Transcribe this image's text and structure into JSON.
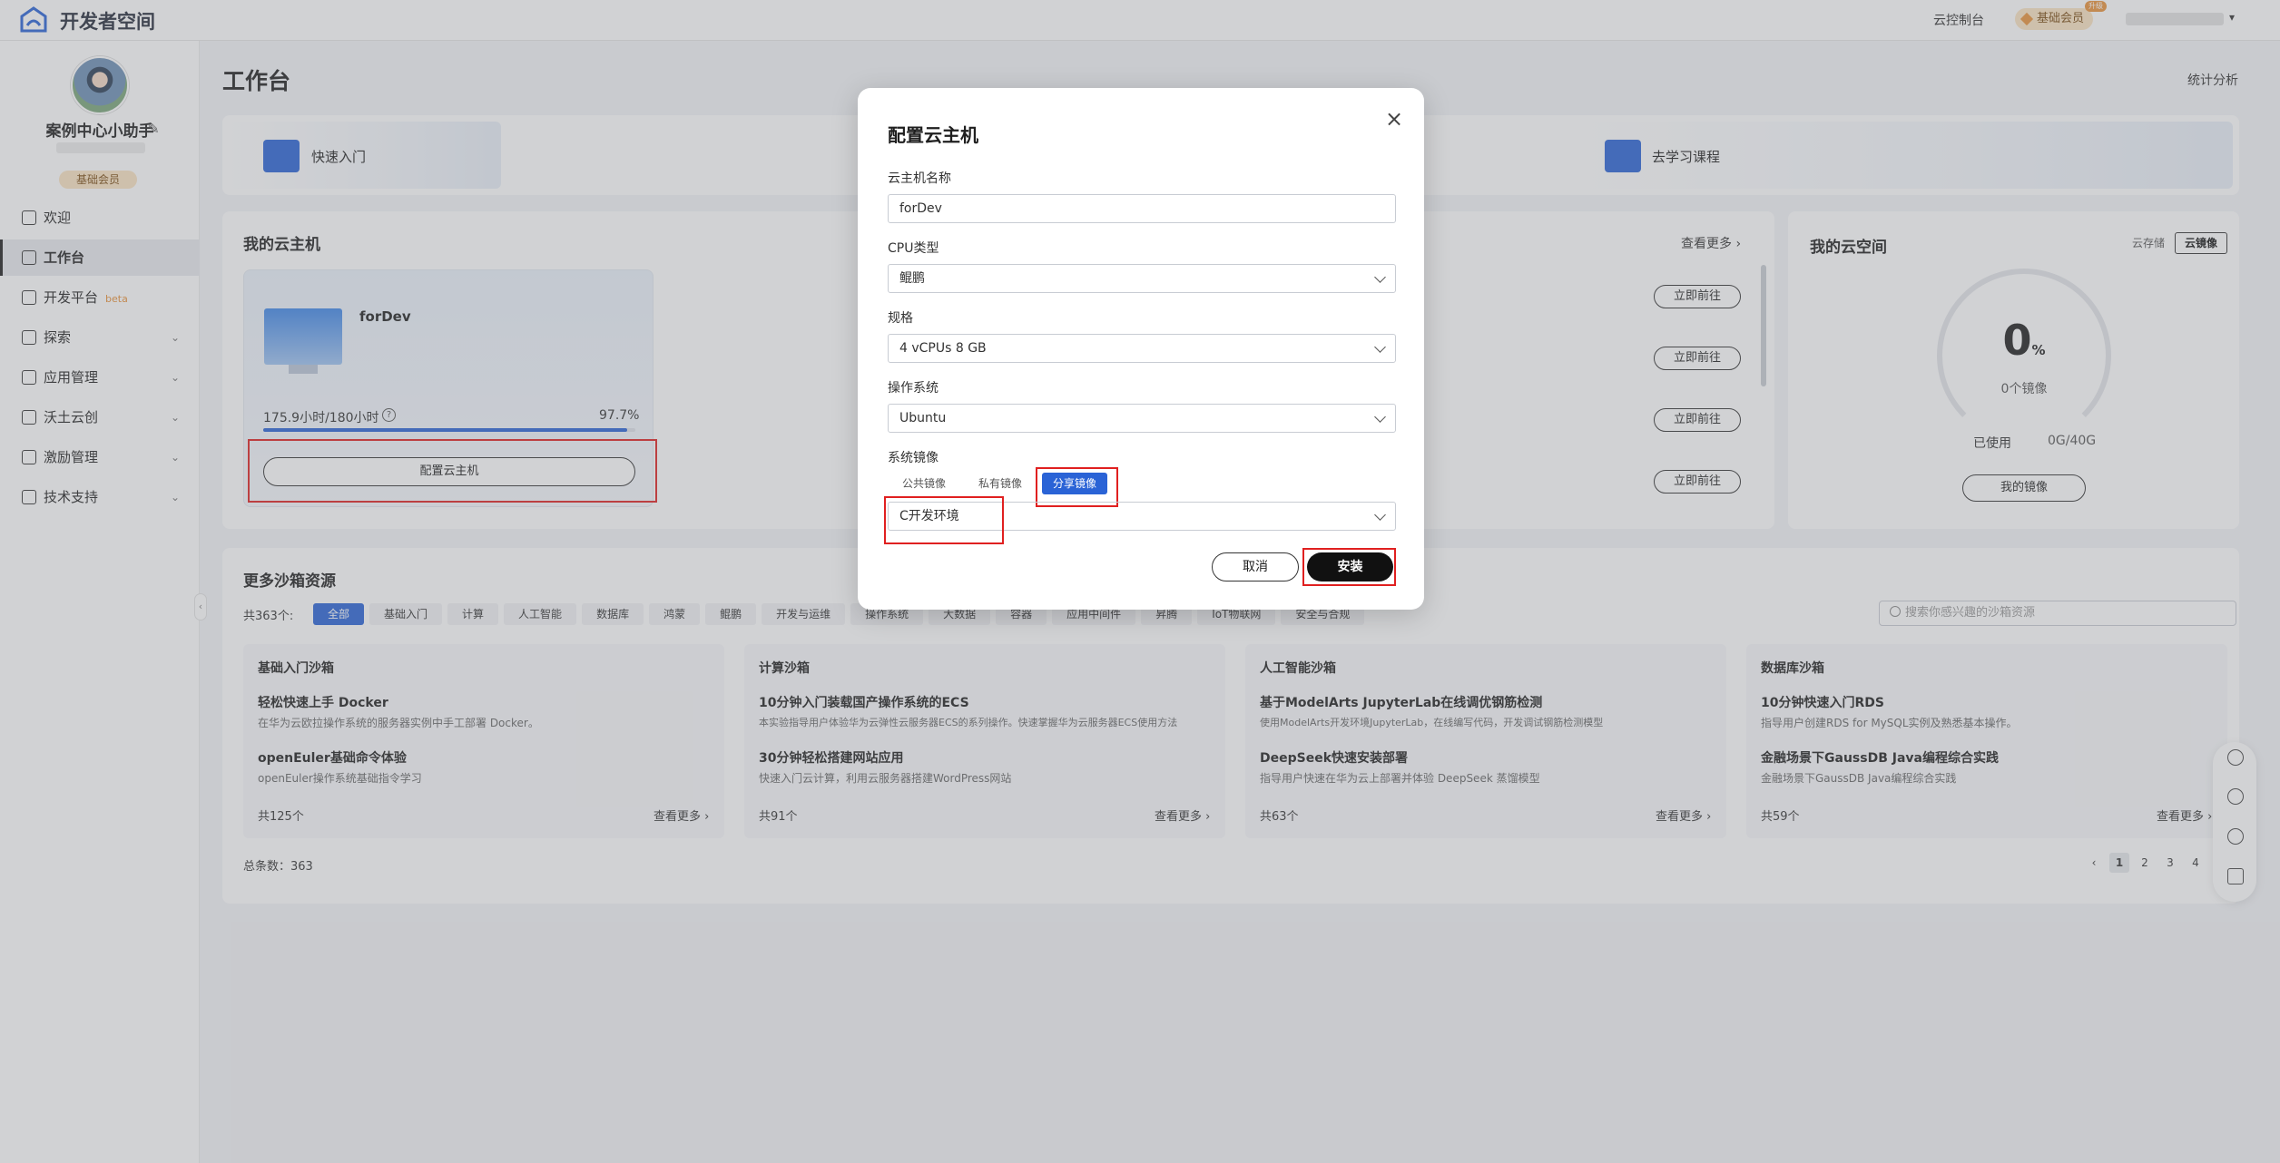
{
  "topbar": {
    "logo_text": "开发者空间",
    "console": "云控制台",
    "member_badge": "基础会员",
    "member_tag": "升级",
    "caret": "▾"
  },
  "sidebar": {
    "username": "案例中心小助手",
    "member": "基础会员",
    "items": [
      {
        "label": "欢迎",
        "icon": "home-icon"
      },
      {
        "label": "工作台",
        "icon": "desk-icon"
      },
      {
        "label": "开发平台",
        "icon": "monitor-icon",
        "badge": "beta"
      },
      {
        "label": "探索",
        "icon": "compass-icon"
      },
      {
        "label": "应用管理",
        "icon": "app-icon"
      },
      {
        "label": "沃土云创",
        "icon": "cloud-icon"
      },
      {
        "label": "激励管理",
        "icon": "gift-icon"
      },
      {
        "label": "技术支持",
        "icon": "support-icon"
      }
    ]
  },
  "main": {
    "title": "工作台",
    "stats_link": "统计分析",
    "quick": [
      {
        "label": "快速入门"
      },
      {
        "label": "去学习课程"
      }
    ],
    "cloud": {
      "title": "我的云主机",
      "see_more": "查看更多 ›",
      "vm_name": "forDev",
      "hours": "175.9小时/180小时",
      "percent_text": "97.7%",
      "percent_value": 0.977,
      "config_button": "配置云主机",
      "goto_label": "立即前往"
    },
    "space": {
      "title": "我的云空间",
      "tab_storage": "云存储",
      "tab_image": "云镜像",
      "ring_value": "0",
      "ring_unit": "%",
      "ring_label": "0个镜像",
      "used_label": "已使用",
      "used_value": "0G/40G",
      "my_image_button": "我的镜像"
    },
    "sandbox": {
      "title": "更多沙箱资源",
      "total_label": "共363个:",
      "filters": [
        "全部",
        "基础入门",
        "计算",
        "人工智能",
        "数据库",
        "鸿蒙",
        "鲲鹏",
        "开发与运维",
        "操作系统",
        "大数据",
        "容器",
        "应用中间件",
        "昇腾",
        "IoT物联网",
        "安全与合规"
      ],
      "search_placeholder": "搜索你感兴趣的沙箱资源",
      "categories": [
        {
          "title": "基础入门沙箱",
          "items": [
            {
              "title": "轻松快速上手 Docker",
              "desc": "在华为云欧拉操作系统的服务器实例中手工部署 Docker。"
            },
            {
              "title": "openEuler基础命令体验",
              "desc": "openEuler操作系统基础指令学习"
            }
          ],
          "count": "共125个",
          "more": "查看更多 ›"
        },
        {
          "title": "计算沙箱",
          "items": [
            {
              "title": "10分钟入门装载国产操作系统的ECS",
              "desc": "本实验指导用户体验华为云弹性云服务器ECS的系列操作。快速掌握华为云服务器ECS使用方法"
            },
            {
              "title": "30分钟轻松搭建网站应用",
              "desc": "快速入门云计算，利用云服务器搭建WordPress网站"
            }
          ],
          "count": "共91个",
          "more": "查看更多 ›"
        },
        {
          "title": "人工智能沙箱",
          "items": [
            {
              "title": "基于ModelArts JupyterLab在线调优钢筋检测",
              "desc": "使用ModelArts开发环境JupyterLab，在线编写代码，开发调试钢筋检测模型"
            },
            {
              "title": "DeepSeek快速安装部署",
              "desc": "指导用户快速在华为云上部署并体验 DeepSeek 蒸馏模型"
            }
          ],
          "count": "共63个",
          "more": "查看更多 ›"
        },
        {
          "title": "数据库沙箱",
          "items": [
            {
              "title": "10分钟快速入门RDS",
              "desc": "指导用户创建RDS for MySQL实例及熟悉基本操作。"
            },
            {
              "title": "金融场景下GaussDB Java编程综合实践",
              "desc": "金融场景下GaussDB Java编程综合实践"
            }
          ],
          "count": "共59个",
          "more": "查看更多 ›"
        }
      ],
      "total_count": "总条数：363",
      "pages": [
        "‹",
        "1",
        "2",
        "3",
        "4"
      ]
    }
  },
  "modal": {
    "title": "配置云主机",
    "name_label": "云主机名称",
    "name_value": "forDev",
    "cpu_label": "CPU类型",
    "cpu_value": "鲲鹏",
    "spec_label": "规格",
    "spec_value": "4 vCPUs 8 GB",
    "os_label": "操作系统",
    "os_value": "Ubuntu",
    "image_label": "系统镜像",
    "image_tabs": [
      "公共镜像",
      "私有镜像",
      "分享镜像"
    ],
    "image_value": "C开发环境",
    "cancel": "取消",
    "install": "安装"
  },
  "colors": {
    "accent": "#2a63d6",
    "highlight": "#e02020",
    "primary_button": "#111111"
  }
}
